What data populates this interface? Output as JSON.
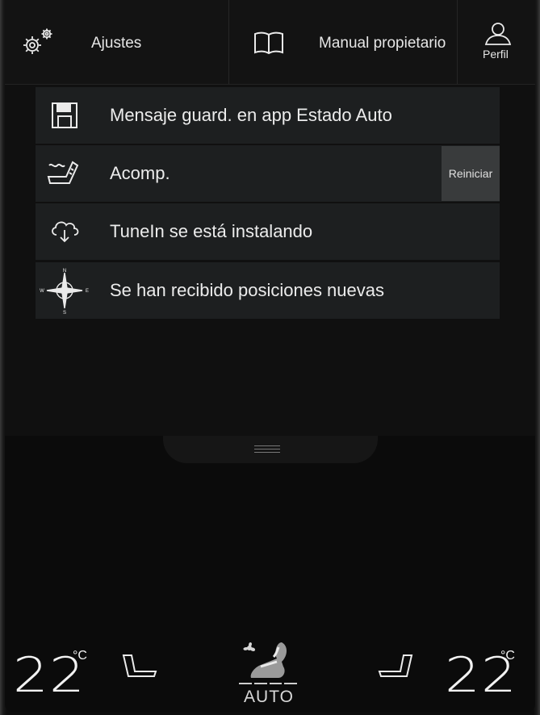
{
  "topbar": {
    "settings_label": "Ajustes",
    "manual_label": "Manual propietario",
    "profile_label": "Perfil"
  },
  "notifications": [
    {
      "icon": "save-floppy-icon",
      "text": "Mensaje guard. en app Estado Auto"
    },
    {
      "icon": "seat-massage-icon",
      "text": "Acomp.",
      "button": "Reiniciar"
    },
    {
      "icon": "cloud-download-icon",
      "text": "TuneIn se está instalando"
    },
    {
      "icon": "compass-rose-icon",
      "text": "Se han recibido posiciones nuevas"
    }
  ],
  "climate": {
    "left_temp": "22",
    "right_temp": "22",
    "unit": "°C",
    "auto_label": "AUTO"
  }
}
